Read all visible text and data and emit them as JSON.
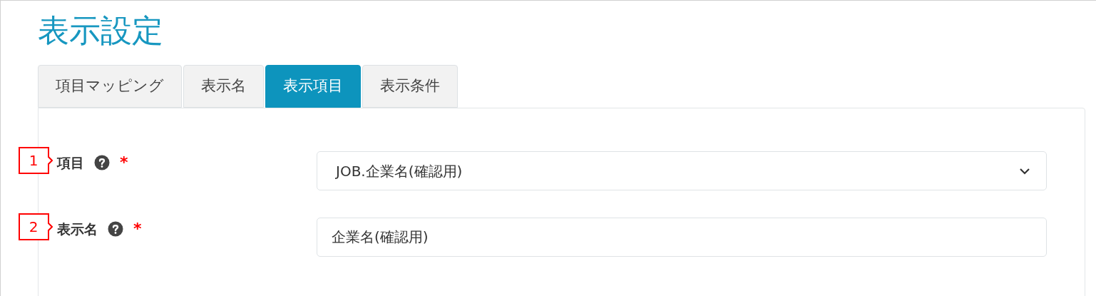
{
  "title": "表示設定",
  "tabs": [
    {
      "label": "項目マッピング",
      "selected": false
    },
    {
      "label": "表示名",
      "selected": false
    },
    {
      "label": "表示項目",
      "selected": true
    },
    {
      "label": "表示条件",
      "selected": false
    }
  ],
  "fields": [
    {
      "callout": "1",
      "label": "項目",
      "required_mark": "*",
      "kind": "select",
      "value": "JOB.企業名(確認用)"
    },
    {
      "callout": "2",
      "label": "表示名",
      "required_mark": "*",
      "kind": "text",
      "value": "企業名(確認用)"
    }
  ]
}
